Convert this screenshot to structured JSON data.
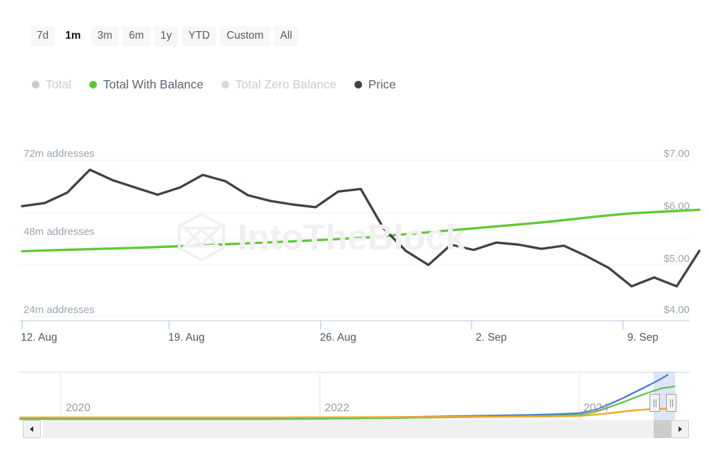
{
  "range_selector": {
    "name": "time-range-selector",
    "buttons": [
      {
        "label": "7d",
        "selected": false
      },
      {
        "label": "1m",
        "selected": true
      },
      {
        "label": "3m",
        "selected": false
      },
      {
        "label": "6m",
        "selected": false
      },
      {
        "label": "1y",
        "selected": false
      },
      {
        "label": "YTD",
        "selected": false
      },
      {
        "label": "Custom",
        "selected": false
      },
      {
        "label": "All",
        "selected": false
      }
    ]
  },
  "legend": {
    "items": [
      {
        "label": "Total",
        "color": "#c9cbcd",
        "active": false
      },
      {
        "label": "Total With Balance",
        "color": "#5fc836",
        "active": true
      },
      {
        "label": "Total Zero Balance",
        "color": "#d6d8da",
        "active": false
      },
      {
        "label": "Price",
        "color": "#3d4349",
        "active": true
      }
    ]
  },
  "watermark": {
    "text": "IntoTheBlock",
    "color": "#f0f0f0"
  },
  "navigator": {
    "years": [
      "2020",
      "2022",
      "2024"
    ],
    "series_colors": {
      "blue": "#4a7ddb",
      "green": "#6abf4b",
      "orange": "#f0a830"
    },
    "scroll_left_label": "scroll-left",
    "scroll_right_label": "scroll-right"
  },
  "chart_data": {
    "type": "line",
    "title": "",
    "xlabel": "",
    "ylabel": "addresses",
    "y2label": "Price",
    "grid": true,
    "legend_position": "top",
    "x_ticks": [
      "12. Aug",
      "19. Aug",
      "26. Aug",
      "2. Sep",
      "9. Sep"
    ],
    "y_left_ticks": [
      "24m addresses",
      "48m addresses",
      "72m addresses"
    ],
    "y_left_values": [
      24000000,
      48000000,
      72000000
    ],
    "y_left_unit": "addresses",
    "y_right_ticks": [
      "$4.00",
      "$5.00",
      "$6.00",
      "$7.00"
    ],
    "y_right_values": [
      4.0,
      5.0,
      6.0,
      7.0
    ],
    "ylim_left": [
      8000000,
      80000000
    ],
    "ylim_right": [
      3.67,
      7.33
    ],
    "x": [
      "2024-08-12",
      "2024-08-13",
      "2024-08-14",
      "2024-08-15",
      "2024-08-16",
      "2024-08-17",
      "2024-08-18",
      "2024-08-19",
      "2024-08-20",
      "2024-08-21",
      "2024-08-22",
      "2024-08-23",
      "2024-08-24",
      "2024-08-25",
      "2024-08-26",
      "2024-08-27",
      "2024-08-28",
      "2024-08-29",
      "2024-08-30",
      "2024-08-31",
      "2024-09-01",
      "2024-09-02",
      "2024-09-03",
      "2024-09-04",
      "2024-09-05",
      "2024-09-06",
      "2024-09-07",
      "2024-09-08",
      "2024-09-09",
      "2024-09-10",
      "2024-09-11"
    ],
    "series": [
      {
        "name": "Total With Balance",
        "color": "#5fc836",
        "axis": "left",
        "unit": "addresses",
        "values": [
          44100000,
          44300000,
          44500000,
          44700000,
          44900000,
          45100000,
          45350000,
          45600000,
          45900000,
          46200000,
          46500000,
          46800000,
          47100000,
          47450000,
          47800000,
          48200000,
          48700000,
          49300000,
          49900000,
          50500000,
          51100000,
          51700000,
          52300000,
          52900000,
          53600000,
          54400000,
          55100000,
          55700000,
          56100000,
          56450000,
          56800000
        ]
      },
      {
        "name": "Price",
        "color": "#3d4349",
        "axis": "right",
        "unit": "USD",
        "values": [
          6.12,
          6.18,
          6.38,
          6.82,
          6.62,
          6.48,
          6.34,
          6.48,
          6.72,
          6.6,
          6.33,
          6.22,
          6.15,
          6.1,
          6.4,
          6.45,
          5.7,
          5.26,
          4.99,
          5.38,
          5.28,
          5.42,
          5.38,
          5.3,
          5.36,
          5.16,
          4.93,
          4.58,
          4.75,
          4.58,
          5.26
        ]
      }
    ]
  }
}
